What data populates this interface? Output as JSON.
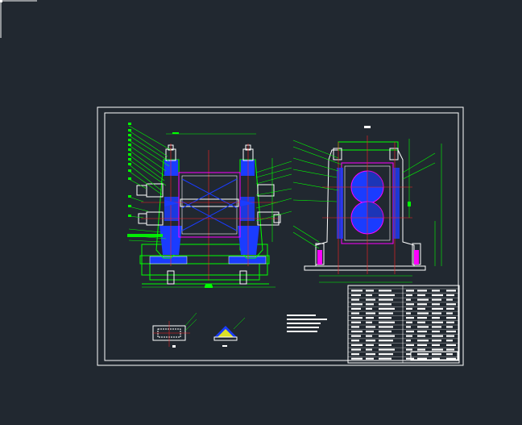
{
  "app": {
    "mode": "cad-model-space"
  },
  "colors": {
    "background": "#212830",
    "border": "#ffffff",
    "outline": "#00ff00",
    "blue": "#1a3cff",
    "red": "#ff2020",
    "magenta": "#ff00ff",
    "yellow": "#ffff00",
    "cyan": "#00ffff"
  },
  "drawing": {
    "views": [
      "front-view",
      "side-view",
      "detail-section-a",
      "detail-section-b"
    ],
    "title_block": {
      "rows": 16
    }
  }
}
